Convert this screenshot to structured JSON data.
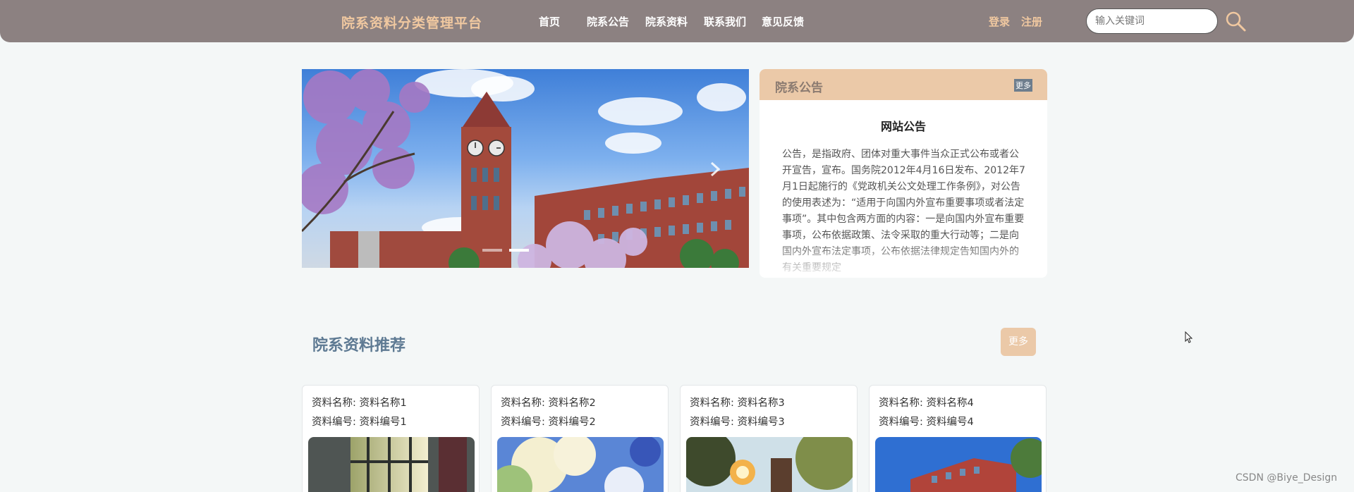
{
  "header": {
    "brand": "院系资料分类管理平台",
    "nav": [
      "首页",
      "院系公告",
      "院系资料",
      "联系我们",
      "意见反馈"
    ],
    "login": "登录",
    "register": "注册",
    "search_placeholder": "输入关键词",
    "search_icon": "search-icon"
  },
  "carousel": {
    "slide_count": 2,
    "active_index": 1,
    "next_icon": "chevron-right-icon"
  },
  "notice": {
    "header_title": "院系公告",
    "more": "更多",
    "title": "网站公告",
    "body": "公告，是指政府、团体对重大事件当众正式公布或者公开宣告，宣布。国务院2012年4月16日发布、2012年7月1日起施行的《党政机关公文处理工作条例》，对公告的使用表述为：“适用于向国内外宣布重要事项或者法定事项”。其中包含两方面的内容：一是向国内外宣布重要事项，公布依据政策、法令采取的重大行动等；二是向国内外宣布法定事项，公布依据法律规定告知国内外的有关重要规定"
  },
  "recommend": {
    "title": "院系资料推荐",
    "more": "更多",
    "items": [
      {
        "name": "资料名称: 资料名称1",
        "code": "资料编号: 资料编号1"
      },
      {
        "name": "资料名称: 资料名称2",
        "code": "资料编号: 资料编号2"
      },
      {
        "name": "资料名称: 资料名称3",
        "code": "资料编号: 资料编号3"
      },
      {
        "name": "资料名称: 资料名称4",
        "code": "资料编号: 资料编号4"
      }
    ]
  },
  "watermark": "CSDN @Biye_Design",
  "colors": {
    "header_bg": "#8c8181",
    "accent_peach": "#ebc9a8",
    "brand_text": "#f0c8a0",
    "section_title": "#5e7a93"
  }
}
